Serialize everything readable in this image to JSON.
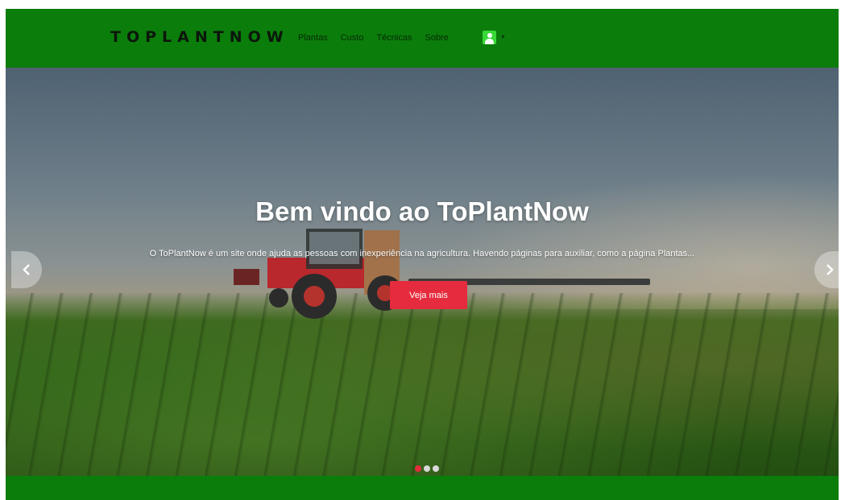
{
  "navbar": {
    "brand": "TOPLANTNOW",
    "links": [
      {
        "label": "Plantas"
      },
      {
        "label": "Custo"
      },
      {
        "label": "Técnicas"
      },
      {
        "label": "Sobre"
      }
    ],
    "user_icon": "user-icon",
    "dropdown_icon": "chevron-down-icon"
  },
  "hero": {
    "title": "Bem vindo ao ToPlantNow",
    "description": "O ToPlantNow é um site onde ajuda as pessoas com inexperiência na agricultura. Havendo páginas para auxiliar, como a página Plantas...",
    "button_label": "Veja mais",
    "prev_icon": "chevron-left-icon",
    "next_icon": "chevron-right-icon",
    "slides_count": 3,
    "active_slide": 1
  },
  "colors": {
    "navbar": "#0b7d0b",
    "accent": "#e52b3d",
    "user_icon_bg": "#38d838"
  }
}
